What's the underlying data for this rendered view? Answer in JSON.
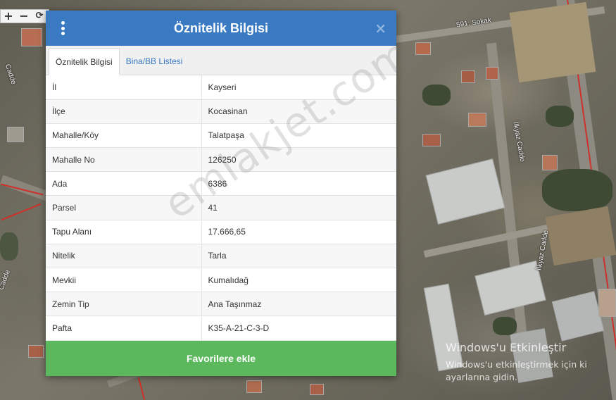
{
  "map": {
    "zoom_in": "+",
    "zoom_out": "−",
    "street_labels": [
      "591. Sokak",
      "İlkyaz Cadde",
      "İlkyaz Cadde",
      "Cadde",
      "Cadde"
    ]
  },
  "modal": {
    "title": "Öznitelik Bilgisi",
    "close_label": "×",
    "tabs": [
      {
        "label": "Öznitelik Bilgisi",
        "active": true
      },
      {
        "label": "Bina/BB Listesi",
        "active": false
      }
    ],
    "rows": [
      {
        "key": "İl",
        "value": "Kayseri"
      },
      {
        "key": "İlçe",
        "value": "Kocasinan"
      },
      {
        "key": "Mahalle/Köy",
        "value": "Talatpaşa"
      },
      {
        "key": "Mahalle No",
        "value": "126250"
      },
      {
        "key": "Ada",
        "value": "6386"
      },
      {
        "key": "Parsel",
        "value": "41"
      },
      {
        "key": "Tapu Alanı",
        "value": "17.666,65"
      },
      {
        "key": "Nitelik",
        "value": "Tarla"
      },
      {
        "key": "Mevkii",
        "value": "Kumalıdağ"
      },
      {
        "key": "Zemin Tip",
        "value": "Ana Taşınmaz"
      },
      {
        "key": "Pafta",
        "value": "K35-A-21-C-3-D"
      }
    ],
    "favorite_button": "Favorilere ekle"
  },
  "watermark": "emlakjet.com",
  "windows_notice": {
    "title": "Windows'u Etkinleştir",
    "line1": "Windows'u etkinleştirmek için ki",
    "line2": "ayarlarına gidin."
  },
  "colors": {
    "header": "#3a7ac2",
    "favorite": "#5cb85c"
  }
}
